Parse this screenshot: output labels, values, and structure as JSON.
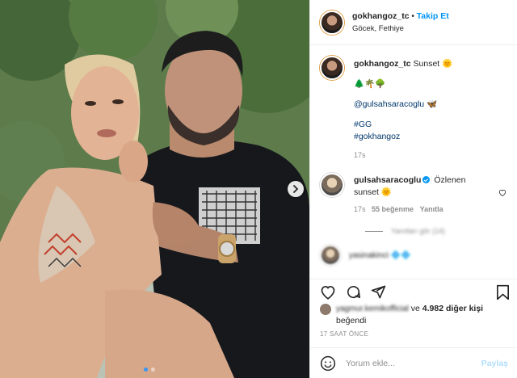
{
  "post": {
    "username": "gokhangoz_tc",
    "separator": "•",
    "follow_label": "Takip Et",
    "location": "Göcek, Fethiye"
  },
  "caption": {
    "username": "gokhangoz_tc",
    "text": "Sunset 🌞",
    "emoji_line": "🌲🌴🌳",
    "mention": "@gulsahsaracoglu 🦋",
    "hashtag1": "#GG",
    "hashtag2": "#gokhangoz",
    "time": "17s"
  },
  "comment": {
    "username": "gulsahsaracoglu",
    "text": "Özlenen sunset 🌞",
    "time": "17s",
    "likes": "55 beğenme",
    "reply_label": "Yanıtla",
    "replies_blurred": "Yanıtları gör (14)"
  },
  "comment2": {
    "blurred": "yasinakinci 💠💠"
  },
  "likes": {
    "blurred_user": "yagmur.kemikofficial",
    "connector": "ve",
    "others": "4.982 diğer kişi",
    "suffix": "beğendi"
  },
  "timestamp": "17 SAAT ÖNCE",
  "composer": {
    "placeholder": "Yorum ekle...",
    "post_label": "Paylaş"
  },
  "carousel": {
    "slide_count": 2,
    "active_index": 0
  },
  "colors": {
    "link_blue": "#0095f6",
    "tag_blue": "#00376b",
    "muted": "#8e8e8e",
    "post_disabled": "#b2dffc"
  },
  "icons": [
    "heart-icon",
    "comment-icon",
    "share-icon",
    "bookmark-icon",
    "emoji-icon",
    "chevron-right-icon",
    "verified-icon"
  ]
}
